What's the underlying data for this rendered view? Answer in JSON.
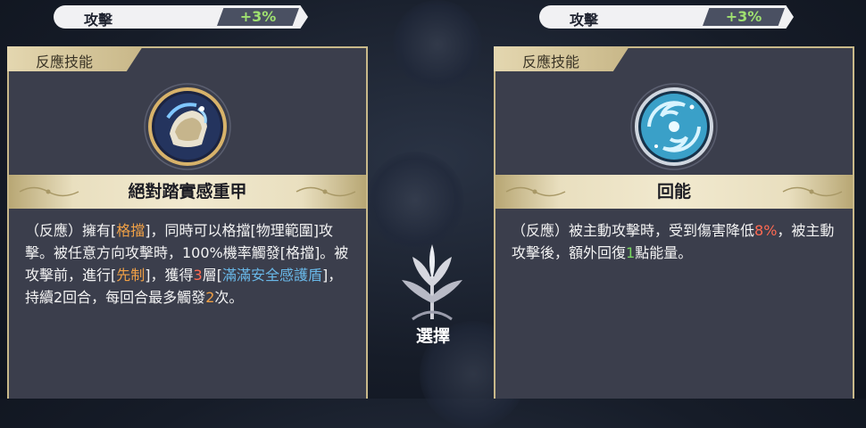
{
  "stats": {
    "left": {
      "label": "攻擊",
      "value": "+3%"
    },
    "right": {
      "label": "攻擊",
      "value": "+3%"
    }
  },
  "cards": [
    {
      "tab": "反應技能",
      "title": "絕對踏實感重甲",
      "desc": {
        "p1": "（反應）擁有[",
        "h1": "格擋",
        "p2": "]，同時可以格擋[物理範圍]攻擊。被任意方向攻擊時，100%機率觸發[格擋]。被攻擊前，進行[",
        "h2": "先制",
        "p3": "]，獲得",
        "h3": "3",
        "p4": "層[",
        "h4": "滿滿安全感護盾",
        "p5": "]，持續2回合，每回合最多觸發",
        "h5": "2",
        "p6": "次。"
      },
      "icon": "armor-skill-icon"
    },
    {
      "tab": "反應技能",
      "title": "回能",
      "desc": {
        "p1": "（反應）被主動攻擊時，受到傷害降低",
        "h1": "8%",
        "p2": "，被主動攻擊後，額外回復",
        "h2": "1",
        "p3": "點能量。"
      },
      "icon": "swirl-energy-icon"
    }
  ],
  "select_label": "選擇",
  "colors": {
    "accent_gold": "#c9b98a",
    "stat_green": "#9fe070",
    "highlight_orange": "#f0a046",
    "highlight_red": "#ff6a52",
    "highlight_blue": "#69b8e8",
    "highlight_green": "#78d860"
  }
}
